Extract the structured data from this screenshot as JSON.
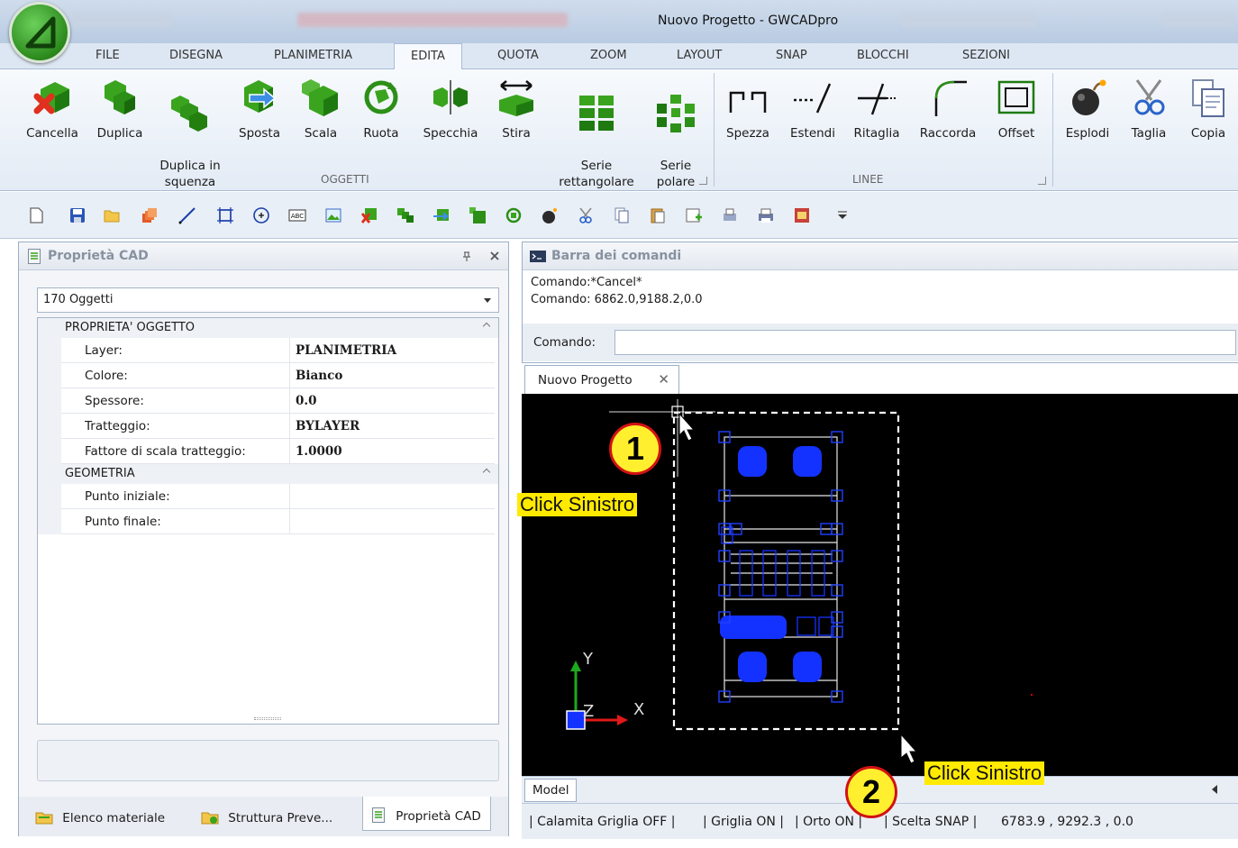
{
  "window": {
    "title": "Nuovo Progetto - GWCADpro"
  },
  "ribbon_tabs": [
    "FILE",
    "DISEGNA",
    "PLANIMETRIA",
    "EDITA",
    "QUOTA",
    "ZOOM",
    "LAYOUT",
    "SNAP",
    "BLOCCHI",
    "SEZIONI"
  ],
  "ribbon": {
    "oggetti": {
      "label": "OGGETTI",
      "buttons": [
        "Cancella",
        "Duplica",
        "Duplica in\nsquenza",
        "Sposta",
        "Scala",
        "Ruota",
        "Specchia",
        "Stira",
        "Serie\nrettangolare",
        "Serie\npolare"
      ]
    },
    "linee": {
      "label": "LINEE",
      "buttons": [
        "Spezza",
        "Estendi",
        "Ritaglia",
        "Raccorda",
        "Offset"
      ]
    },
    "extra": {
      "buttons": [
        "Esplodi",
        "Taglia",
        "Copia"
      ]
    }
  },
  "left_panel": {
    "title": "Proprietà CAD",
    "object_count": "170 Oggetti",
    "categories": [
      {
        "name": "PROPRIETA' OGGETTO",
        "rows": [
          {
            "key": "Layer:",
            "value": "PLANIMETRIA"
          },
          {
            "key": "Colore:",
            "value": "Bianco"
          },
          {
            "key": "Spessore:",
            "value": "0.0"
          },
          {
            "key": "Tratteggio:",
            "value": "BYLAYER"
          },
          {
            "key": "Fattore di scala tratteggio:",
            "value": "1.0000"
          }
        ]
      },
      {
        "name": "GEOMETRIA",
        "rows": [
          {
            "key": "Punto iniziale:",
            "value": ""
          },
          {
            "key": "Punto finale:",
            "value": ""
          }
        ]
      }
    ],
    "bottom_tabs": [
      "Elenco materiale",
      "Struttura Preve...",
      "Proprietà CAD"
    ]
  },
  "command_panel": {
    "title": "Barra dei comandi",
    "history": [
      "Comando:*Cancel*",
      "Comando: 6862.0,9188.2,0.0"
    ],
    "input_label": "Comando:",
    "input_value": ""
  },
  "document": {
    "tab": "Nuovo Progetto",
    "model_tab": "Model",
    "axis_labels": {
      "x": "X",
      "y": "Y",
      "z": "Z"
    }
  },
  "status_bar": {
    "calamita": "| Calamita Griglia OFF |",
    "griglia": "| Griglia ON |",
    "orto": "| Orto ON |",
    "snap": "| Scelta SNAP |",
    "coords": "6783.9 , 9292.3 , 0.0"
  },
  "annotations": {
    "step1": {
      "number": "1",
      "label": "Click Sinistro"
    },
    "step2": {
      "number": "2",
      "label": "Click Sinistro"
    }
  },
  "colors": {
    "selection_blue": "#1432ff",
    "callout_yellow": "#ffea00",
    "badge_ring": "#d21212",
    "canvas_bg": "#000000"
  }
}
